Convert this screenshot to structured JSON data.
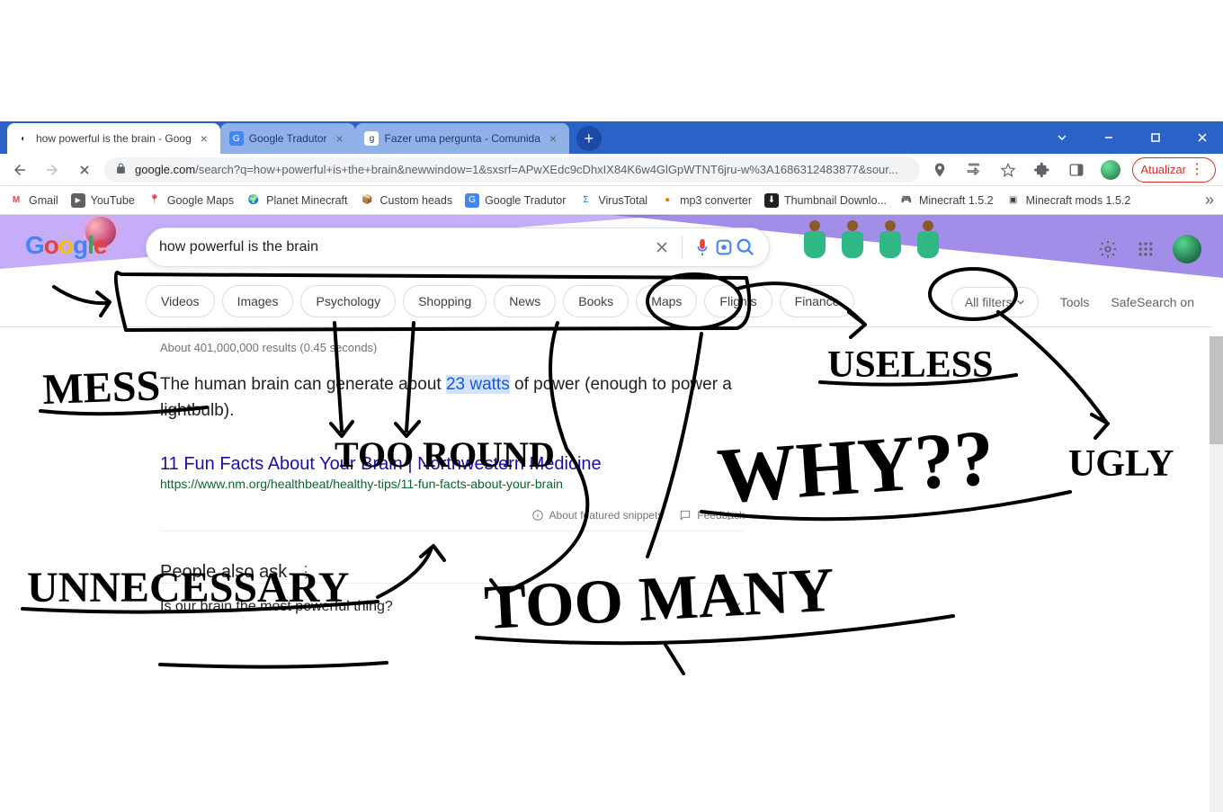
{
  "browser": {
    "tabs": [
      {
        "title": "how powerful is the brain - Goog",
        "active": true,
        "favicon_bg": "#fff",
        "favicon_symbol": "◐"
      },
      {
        "title": "Google Tradutor",
        "active": false,
        "favicon_bg": "#4285F4",
        "favicon_symbol": "G"
      },
      {
        "title": "Fazer uma pergunta - Comunida",
        "active": false,
        "favicon_bg": "#34A853",
        "favicon_symbol": "g"
      }
    ],
    "url": "google.com/search?q=how+powerful+is+the+brain&newwindow=1&sxsrf=APwXEdc9cDhxIX84K6w4GlGpWTNT6jru-w%3A1686312483877&sour...",
    "update_label": "Atualizar"
  },
  "bookmarks": [
    {
      "label": "Gmail",
      "color": "#EA4335",
      "glyph": "M"
    },
    {
      "label": "YouTube",
      "color": "#606060",
      "glyph": "▶"
    },
    {
      "label": "Google Maps",
      "color": "#34A853",
      "glyph": "📍"
    },
    {
      "label": "Planet Minecraft",
      "color": "#2e7d32",
      "glyph": "🌍"
    },
    {
      "label": "Custom heads",
      "color": "#8d6e63",
      "glyph": "📦"
    },
    {
      "label": "Google Tradutor",
      "color": "#4285F4",
      "glyph": "G"
    },
    {
      "label": "VirusTotal",
      "color": "#1976d2",
      "glyph": "Σ"
    },
    {
      "label": "mp3 converter",
      "color": "#f57c00",
      "glyph": "●"
    },
    {
      "label": "Thumbnail Downlo...",
      "color": "#212121",
      "glyph": "⬇"
    },
    {
      "label": "Minecraft 1.5.2",
      "color": "#3f9142",
      "glyph": "🎮"
    },
    {
      "label": "Minecraft mods 1.5.2",
      "color": "#6d4c41",
      "glyph": "▣"
    }
  ],
  "search": {
    "query": "how powerful is the brain",
    "chips": [
      "Videos",
      "Images",
      "Psychology",
      "Shopping",
      "News",
      "Books",
      "Maps",
      "Flights",
      "Finance"
    ],
    "all_filters": "All filters",
    "tools": "Tools",
    "safesearch": "SafeSearch on"
  },
  "results": {
    "stats": "About 401,000,000 results (0.45 seconds)",
    "snippet_pre": "The human brain can generate about ",
    "snippet_hl": "23 watts",
    "snippet_post": " of power (enough to power a lightbulb).",
    "r1_title": "11 Fun Facts About Your Brain | Northwestern Medicine",
    "r1_url": "https://www.nm.org/healthbeat/healthy-tips/11-fun-facts-about-your-brain",
    "about_snippets": "About featured snippets",
    "feedback": "Feedback",
    "paa_heading": "People also ask",
    "paa_q1": "Is our brain the most powerful thing?"
  },
  "annotations": {
    "mess": "MESS",
    "too_round": "TOO ROUND",
    "unnecessary": "UNNECESSARY",
    "useless": "USELESS",
    "why": "WHY??",
    "too_many": "TOO MANY",
    "ugly": "UGLY"
  }
}
